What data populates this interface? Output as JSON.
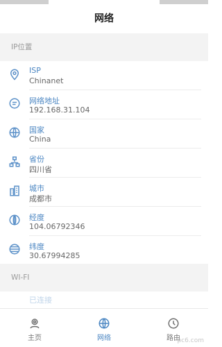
{
  "header": {
    "title": "网络"
  },
  "sections": {
    "ip": {
      "title": "IP位置"
    },
    "wifi": {
      "title": "WI-FI"
    }
  },
  "ip_items": [
    {
      "label": "ISP",
      "value": "Chinanet",
      "icon": "location-pin-icon"
    },
    {
      "label": "网络地址",
      "value": "192.168.31.104",
      "icon": "network-address-icon"
    },
    {
      "label": "国家",
      "value": "China",
      "icon": "globe-icon"
    },
    {
      "label": "省份",
      "value": "四川省",
      "icon": "org-hierarchy-icon"
    },
    {
      "label": "城市",
      "value": "成都市",
      "icon": "city-building-icon"
    },
    {
      "label": "经度",
      "value": "104.06792346",
      "icon": "longitude-icon"
    },
    {
      "label": "纬度",
      "value": "30.67994285",
      "icon": "latitude-icon"
    }
  ],
  "wifi_partial_label": "已连接",
  "tabs": [
    {
      "label": "主页",
      "icon": "home-icon",
      "active": false
    },
    {
      "label": "网络",
      "icon": "globe-icon",
      "active": true
    },
    {
      "label": "路由",
      "icon": "clock-icon",
      "active": false
    }
  ],
  "watermark": "pc6.com",
  "colors": {
    "accent": "#4b86c2",
    "section_bg": "#f3f3f3",
    "muted_text": "#9a9a9a"
  }
}
